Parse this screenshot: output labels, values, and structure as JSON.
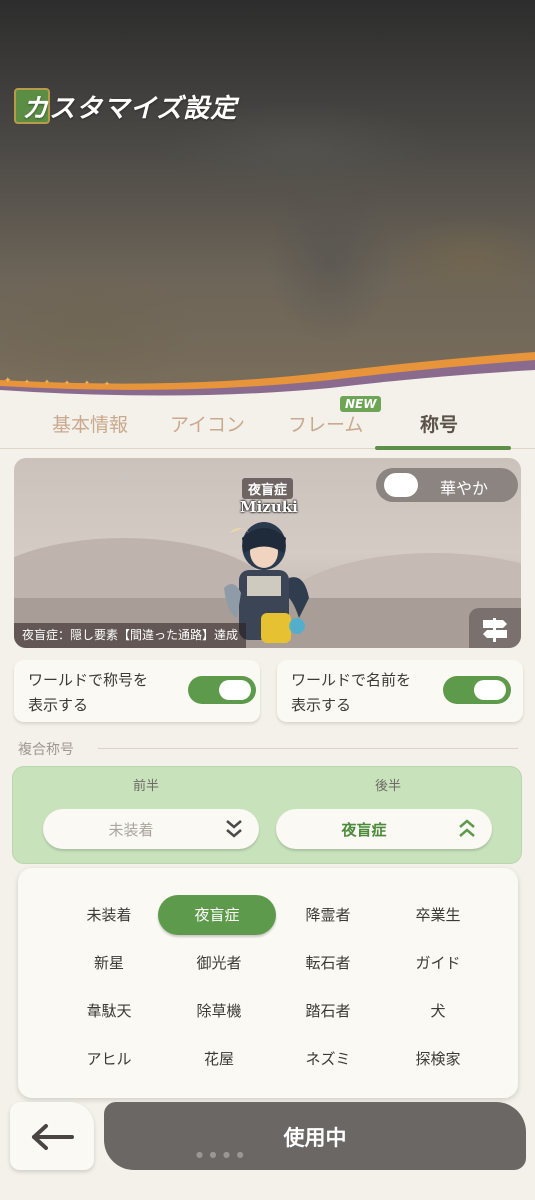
{
  "header": {
    "title": "カスタマイズ設定"
  },
  "tabs": [
    {
      "label": "基本情報",
      "active": false
    },
    {
      "label": "アイコン",
      "active": false
    },
    {
      "label": "フレーム",
      "active": false,
      "badge": "NEW"
    },
    {
      "label": "称号",
      "active": true
    }
  ],
  "preview": {
    "character_title": "夜盲症",
    "character_name": "Mizuki",
    "fancy_toggle_label": "華やか",
    "description": "夜盲症：隠し要素【間違った通路】達成"
  },
  "toggles": {
    "show_title_label": "ワールドで称号を\n表示する",
    "show_title_line1": "ワールドで称号を",
    "show_title_line2": "表示する",
    "show_name_line1": "ワールドで名前を",
    "show_name_line2": "表示する"
  },
  "composite": {
    "section_label": "複合称号",
    "front_label": "前半",
    "back_label": "後半",
    "front_value": "未装着",
    "back_value": "夜盲症"
  },
  "options": [
    [
      "未装着",
      "夜盲症",
      "降霊者",
      "卒業生"
    ],
    [
      "新星",
      "御光者",
      "転石者",
      "ガイド"
    ],
    [
      "韋駄天",
      "除草機",
      "踏石者",
      "犬"
    ],
    [
      "アヒル",
      "花屋",
      "ネズミ",
      "探検家"
    ]
  ],
  "options_flat": {
    "o00": "未装着",
    "o01": "夜盲症",
    "o02": "降霊者",
    "o03": "卒業生",
    "o10": "新星",
    "o11": "御光者",
    "o12": "転石者",
    "o13": "ガイド",
    "o20": "韋駄天",
    "o21": "除草機",
    "o22": "踏石者",
    "o23": "犬",
    "o30": "アヒル",
    "o31": "花屋",
    "o32": "ネズミ",
    "o33": "探検家"
  },
  "selected_option": "夜盲症",
  "footer": {
    "use_label": "使用中"
  },
  "colors": {
    "accent_green": "#5e9a4b",
    "wave_orange": "#e8943a",
    "selected_bg": "#5e9a4b"
  }
}
